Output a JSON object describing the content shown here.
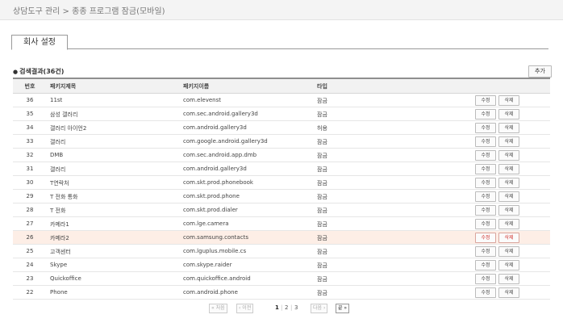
{
  "breadcrumb": "상담도구 관리 > 종종 프로그램 잠금(모바일)",
  "tab": "회사 설정",
  "result": {
    "bullet": "●",
    "title": "검색결과(36건)",
    "add_label": "추가"
  },
  "columns": [
    "번호",
    "패키지제목",
    "패키지이름",
    "타입"
  ],
  "edit_label": "수정",
  "delete_label": "삭제",
  "rows": [
    {
      "no": "36",
      "title": "11st",
      "package": "com.elevenst",
      "type": "잠금"
    },
    {
      "no": "35",
      "title": "삼성 갤러리",
      "package": "com.sec.android.gallery3d",
      "type": "잠금"
    },
    {
      "no": "34",
      "title": "갤러리 아이언2",
      "package": "com.android.gallery3d",
      "type": "허용"
    },
    {
      "no": "33",
      "title": "갤러리",
      "package": "com.google.android.gallery3d",
      "type": "잠금"
    },
    {
      "no": "32",
      "title": "DMB",
      "package": "com.sec.android.app.dmb",
      "type": "잠금"
    },
    {
      "no": "31",
      "title": "갤러리",
      "package": "com.android.gallery3d",
      "type": "잠금"
    },
    {
      "no": "30",
      "title": "T연락처",
      "package": "com.skt.prod.phonebook",
      "type": "잠금"
    },
    {
      "no": "29",
      "title": "T 전화 통화",
      "package": "com.skt.prod.phone",
      "type": "잠금"
    },
    {
      "no": "28",
      "title": "T 전화",
      "package": "com.skt.prod.dialer",
      "type": "잠금"
    },
    {
      "no": "27",
      "title": "카메라1",
      "package": "com.lge.camera",
      "type": "잠금"
    },
    {
      "no": "26",
      "title": "카메라2",
      "package": "com.samsung.contacts",
      "type": "잠금",
      "highlight": true
    },
    {
      "no": "25",
      "title": "고객센터",
      "package": "com.lguplus.mobile.cs",
      "type": "잠금"
    },
    {
      "no": "24",
      "title": "Skype",
      "package": "com.skype.raider",
      "type": "잠금"
    },
    {
      "no": "23",
      "title": "Quickoffice",
      "package": "com.quickoffice.android",
      "type": "잠금"
    },
    {
      "no": "22",
      "title": "Phone",
      "package": "com.android.phone",
      "type": "잠금"
    }
  ],
  "pager": {
    "first": "« 처음",
    "prev": "‹ 이전",
    "pages": [
      "1",
      "2",
      "3"
    ],
    "current": "1",
    "next": "다음 ›",
    "last": "끝 »"
  }
}
